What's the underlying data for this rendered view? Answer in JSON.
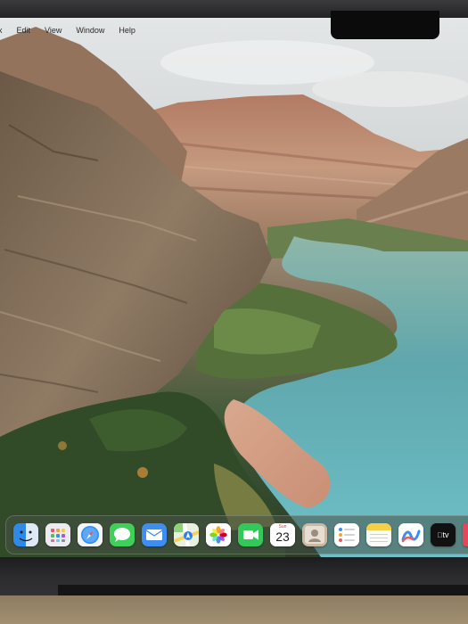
{
  "menu_bar": {
    "items": [
      {
        "label": "x"
      },
      {
        "label": "Edit"
      },
      {
        "label": "View"
      },
      {
        "label": "Window"
      },
      {
        "label": "Help"
      }
    ]
  },
  "dock": {
    "apps": [
      {
        "name": "Finder",
        "icon": "finder-icon"
      },
      {
        "name": "Launchpad",
        "icon": "launchpad-icon"
      },
      {
        "name": "Safari",
        "icon": "safari-icon"
      },
      {
        "name": "Messages",
        "icon": "messages-icon"
      },
      {
        "name": "Mail",
        "icon": "mail-icon"
      },
      {
        "name": "Maps",
        "icon": "maps-icon"
      },
      {
        "name": "Photos",
        "icon": "photos-icon"
      },
      {
        "name": "FaceTime",
        "icon": "facetime-icon"
      },
      {
        "name": "Calendar",
        "icon": "calendar-icon",
        "month": "Sun",
        "day": "23"
      },
      {
        "name": "Contacts",
        "icon": "contacts-icon"
      },
      {
        "name": "Reminders",
        "icon": "reminders-icon"
      },
      {
        "name": "Notes",
        "icon": "notes-icon"
      },
      {
        "name": "Freeform",
        "icon": "freeform-icon"
      },
      {
        "name": "TV",
        "icon": "tv-icon",
        "label": "tv"
      }
    ]
  },
  "colors": {
    "dock_background": "#4b5448",
    "river": "#5fb3be",
    "canyon": "#8a6a55",
    "sky": "#dde2e4"
  }
}
